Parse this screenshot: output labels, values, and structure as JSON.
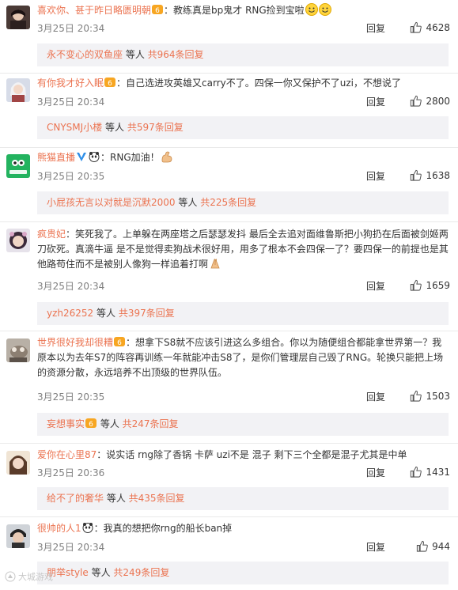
{
  "colors": {
    "username": "#eb7350",
    "meta": "#808080",
    "subbox_bg": "#f2f2f5"
  },
  "comments": [
    {
      "username": "喜欢你、甚于昨日略匮明朝",
      "text": "：教练真是bp鬼才 RNG捡到宝啦",
      "time": "3月25日 20:34",
      "reply": "回复",
      "likes": "4628",
      "sub": {
        "user": "永不变心的双鱼座",
        "mid": " 等人 ",
        "count": "共964条回复"
      }
    },
    {
      "username": "有你我才好入眠",
      "text": "：自己选进攻英雄又carry不了。四保一你又保护不了uzi，不想说了",
      "time": "3月25日 20:34",
      "reply": "回复",
      "likes": "2800",
      "sub": {
        "user": "CNYSMJ小楼",
        "mid": " 等人 ",
        "count": "共597条回复"
      }
    },
    {
      "username": "熊猫直播",
      "text": "：RNG加油！",
      "time": "3月25日 20:35",
      "reply": "回复",
      "likes": "1638",
      "sub": {
        "user": "小屁孩无言以对就是沉默2000",
        "mid": " 等人 ",
        "count": "共225条回复"
      }
    },
    {
      "username": "疯贵妃",
      "text": "：笑死我了。上单躲在两座塔之后瑟瑟发抖 最后全去追对面维鲁斯把小狗扔在后面被剑姬两刀砍死。真滴牛逼 是不是觉得卖狗战术很好用，用多了根本不会四保一了？要四保一的前提也是其他路苟住而不是被别人像狗一样追着打啊",
      "time": "3月25日 20:34",
      "reply": "回复",
      "likes": "1659",
      "sub": {
        "user": "yzh26252",
        "mid": " 等人 ",
        "count": "共397条回复"
      }
    },
    {
      "username": "世界很好我却很糟",
      "text": "：想拿下S8就不应该引进这么多组合。你以为随便组合都能拿世界第一？我原本以为去年S7的阵容再训练一年就能冲击S8了，是你们管理层自己毁了RNG。轮换只能把上场的资源分散，永远培养不出顶级的世界队伍。",
      "time": "3月25日 20:35",
      "reply": "回复",
      "likes": "1503",
      "sub": {
        "user": "妄想事实",
        "mid": " 等人 ",
        "count": "共247条回复"
      }
    },
    {
      "username": "爱你在心里87",
      "text": "：说实话 rng除了香锅 卡萨 uzi不是 混子 剩下三个全都是混子尤其是中单",
      "time": "3月25日 20:36",
      "reply": "回复",
      "likes": "1431",
      "sub": {
        "user": "给不了的奢华",
        "mid": " 等人 ",
        "count": "共435条回复"
      }
    },
    {
      "username": "很帅的人1",
      "text": "：我真的想把你rng的船长ban掉",
      "time": "3月25日 20:34",
      "reply": "回复",
      "likes": "944",
      "sub": {
        "user": "朋举style",
        "mid": " 等人 ",
        "count": "共249条回复"
      }
    }
  ],
  "watermark": "大城游戏"
}
